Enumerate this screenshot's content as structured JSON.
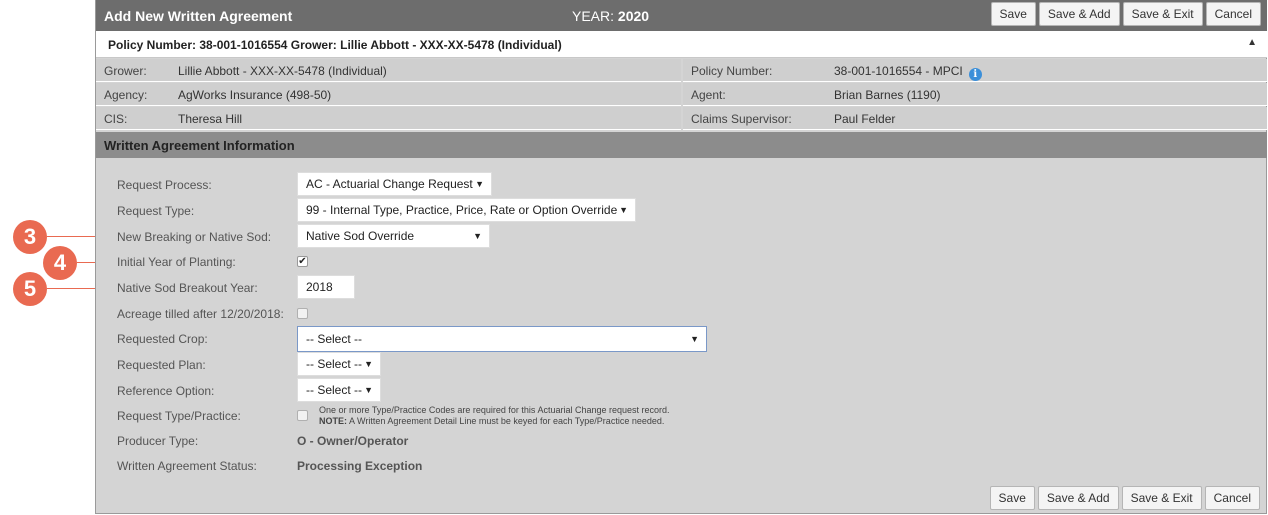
{
  "header": {
    "title": "Add New Written Agreement",
    "year_label": "YEAR:",
    "year_value": "2020",
    "buttons": {
      "save": "Save",
      "save_add": "Save & Add",
      "save_exit": "Save & Exit",
      "cancel": "Cancel"
    }
  },
  "policy_bar": {
    "text": "Policy Number: 38-001-1016554 Grower: Lillie Abbott - XXX-XX-5478 (Individual)",
    "collapse_icon": "caret-up-icon"
  },
  "info": {
    "grower_label": "Grower:",
    "grower_value": "Lillie Abbott - XXX-XX-5478 (Individual)",
    "policy_label": "Policy Number:",
    "policy_value": "38-001-1016554 - MPCI",
    "agency_label": "Agency:",
    "agency_value": "AgWorks Insurance (498-50)",
    "agent_label": "Agent:",
    "agent_value": "Brian Barnes (1190)",
    "cis_label": "CIS:",
    "cis_value": "Theresa Hill",
    "claims_label": "Claims Supervisor:",
    "claims_value": "Paul Felder",
    "info_icon": "i"
  },
  "section": {
    "title": "Written Agreement Information"
  },
  "form": {
    "request_process": {
      "label": "Request Process:",
      "value": "AC - Actuarial Change Request"
    },
    "request_type": {
      "label": "Request Type:",
      "value": "99 - Internal Type, Practice, Price, Rate or Option Override"
    },
    "new_breaking": {
      "label": "New Breaking or Native Sod:",
      "value": "Native Sod Override"
    },
    "initial_year": {
      "label": "Initial Year of Planting:",
      "checked": true
    },
    "breakout_year": {
      "label": "Native Sod Breakout Year:",
      "value": "2018"
    },
    "acreage_tilled": {
      "label": "Acreage tilled after 12/20/2018:",
      "checked": false
    },
    "requested_crop": {
      "label": "Requested Crop:",
      "value": "-- Select --"
    },
    "requested_plan": {
      "label": "Requested Plan:",
      "value": "-- Select --"
    },
    "reference_option": {
      "label": "Reference Option:",
      "value": "-- Select --"
    },
    "request_type_practice": {
      "label": "Request Type/Practice:",
      "note_line1": "One or more Type/Practice Codes are required for this Actuarial Change request record.",
      "note_bold": "NOTE:",
      "note_line2": " A Written Agreement Detail Line must be keyed for each Type/Practice needed."
    },
    "producer_type": {
      "label": "Producer Type:",
      "value": "O - Owner/Operator"
    },
    "status": {
      "label": "Written Agreement Status:",
      "value": "Processing Exception"
    }
  },
  "callouts": [
    "3",
    "4",
    "5"
  ],
  "colors": {
    "callout": "#e96a51",
    "titlebar": "#6d6d6d",
    "section": "#8c8c8c",
    "info_icon": "#3b8fd9"
  }
}
